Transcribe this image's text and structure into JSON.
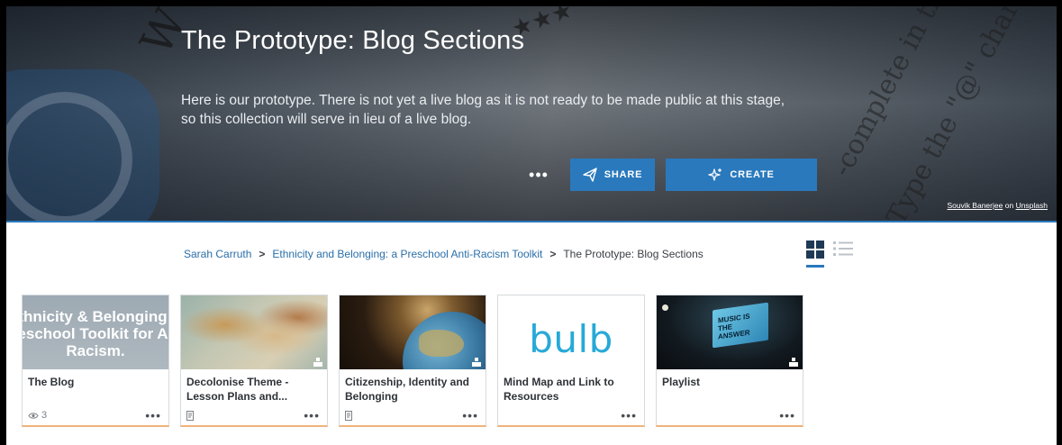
{
  "hero": {
    "title": "The Prototype: Blog Sections",
    "description": "Here is our prototype. There is not yet a live blog as it is not ready to be made public at this stage, so this collection will serve in lieu of a live blog.",
    "more_label": "•••",
    "share_label": "SHARE",
    "create_label": "CREATE",
    "credit_author": "Souvik Banerjee",
    "credit_on": "on",
    "credit_site": "Unsplash"
  },
  "breadcrumb": {
    "items": [
      "Sarah Carruth",
      "Ethnicity and Belonging: a Preschool Anti-Racism Toolkit",
      "The Prototype: Blog Sections"
    ],
    "separator": ">"
  },
  "cards": [
    {
      "title": "The Blog",
      "thumb_text_lines": [
        "thnicity & Belonging",
        "eschool Toolkit for A",
        "Racism."
      ],
      "meta_icon": "eye-icon",
      "meta_value": "3",
      "more_label": "•••"
    },
    {
      "title": "Decolonise Theme - Lesson Plans and...",
      "meta_icon": "note-icon",
      "more_label": "•••"
    },
    {
      "title": "Citizenship, Identity and Belonging",
      "meta_icon": "note-icon",
      "more_label": "•••"
    },
    {
      "title": "Mind Map and Link to Resources",
      "thumb_logo": "bulb",
      "more_label": "•••"
    },
    {
      "title": "Playlist",
      "thumb_sign_text": "MUSIC IS THE ANSWER",
      "more_label": "•••"
    }
  ],
  "colors": {
    "accent": "#2a79bd",
    "card_bottom": "#efb37a",
    "bulb_logo": "#27a9d8"
  }
}
